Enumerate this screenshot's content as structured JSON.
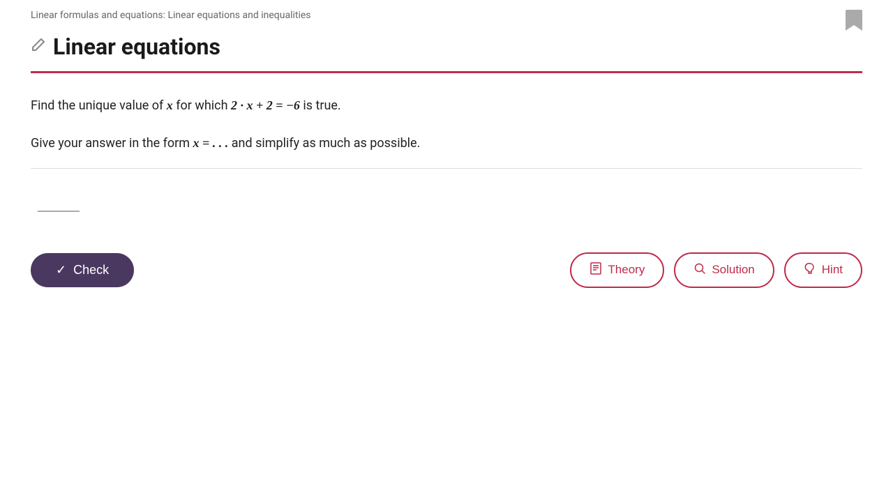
{
  "breadcrumb": {
    "text": "Linear formulas and equations: Linear equations and inequalities"
  },
  "page": {
    "title": "Linear equations",
    "pencil_icon": "✏",
    "bookmark_icon": "🔖"
  },
  "problem": {
    "line1_prefix": "Find the unique value of ",
    "line1_var": "x",
    "line1_middle": " for which ",
    "line1_formula": "2 · x + 2 = −6",
    "line1_suffix": " is true.",
    "line2_prefix": "Give your answer in the form ",
    "line2_formula": "x = . . .",
    "line2_suffix": " and simplify as much as possible."
  },
  "buttons": {
    "check": "Check",
    "theory": "Theory",
    "solution": "Solution",
    "hint": "Hint",
    "check_icon": "✓",
    "theory_icon": "📖",
    "solution_icon": "🔍",
    "hint_icon": "💡"
  },
  "colors": {
    "accent": "#c0294a",
    "button_bg": "#4a3860"
  }
}
